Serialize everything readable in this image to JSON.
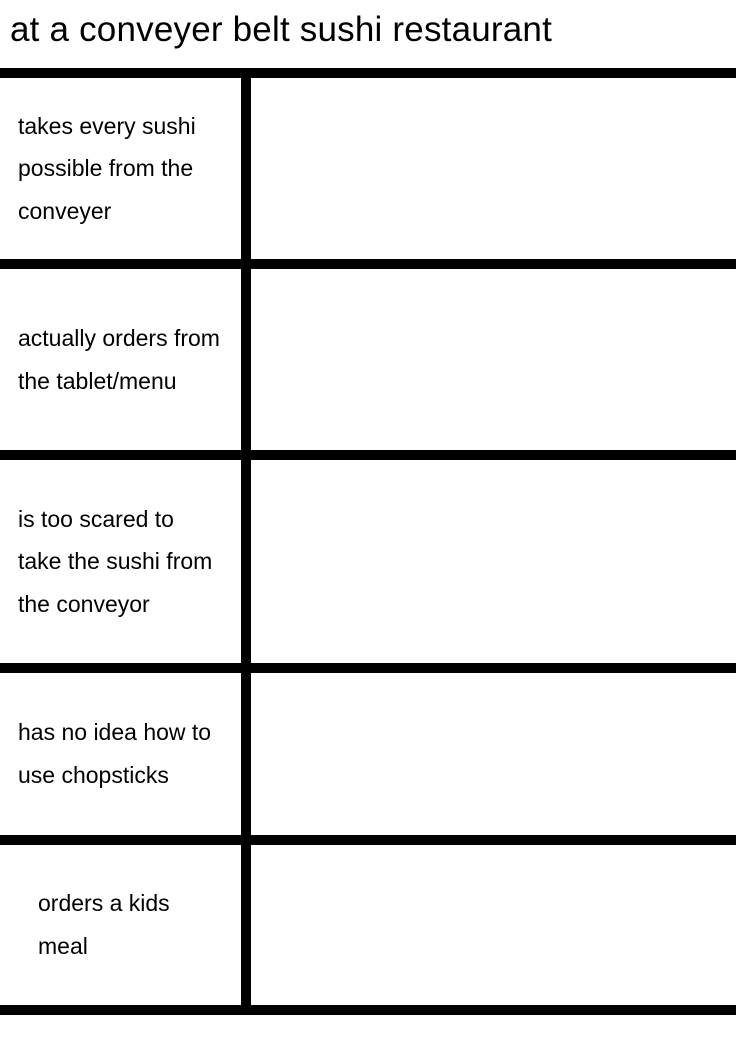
{
  "title": "at a conveyer belt sushi restaurant",
  "rows": [
    {
      "label": "takes every sushi possible from the conveyer"
    },
    {
      "label": "actually orders from the tablet/menu"
    },
    {
      "label": "is too scared to take the sushi from the conveyor"
    },
    {
      "label": "has no idea how to use chopsticks"
    },
    {
      "label": "orders a kids meal"
    }
  ]
}
